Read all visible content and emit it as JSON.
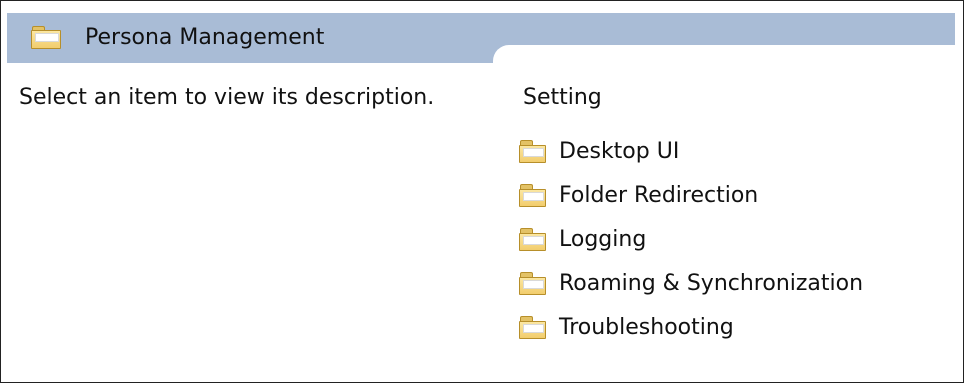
{
  "header": {
    "title": "Persona Management",
    "icon": "folder-icon"
  },
  "left_panel": {
    "description": "Select an item to view its description."
  },
  "settings": {
    "column_header": "Setting",
    "items": [
      {
        "label": "Desktop UI",
        "icon": "folder-icon"
      },
      {
        "label": "Folder Redirection",
        "icon": "folder-icon"
      },
      {
        "label": "Logging",
        "icon": "folder-icon"
      },
      {
        "label": "Roaming & Synchronization",
        "icon": "folder-icon"
      },
      {
        "label": "Troubleshooting",
        "icon": "folder-icon"
      }
    ]
  },
  "colors": {
    "header_band": "#a9bcd6",
    "folder_fill": "#f2cd6d"
  }
}
